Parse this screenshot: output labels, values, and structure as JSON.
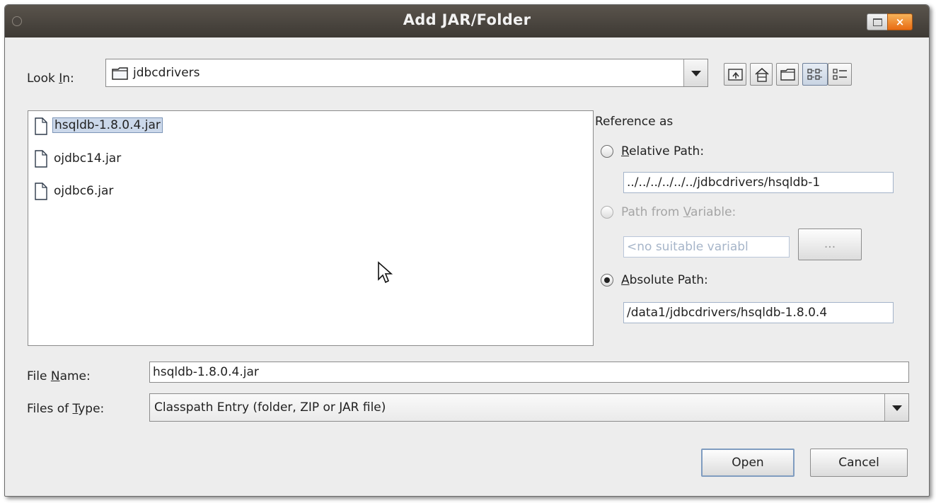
{
  "window": {
    "title": "Add JAR/Folder",
    "close_glyph": "×"
  },
  "lookin": {
    "label_pre": "Look ",
    "label_mn": "I",
    "label_post": "n:",
    "value": "jdbcdrivers"
  },
  "toolbar": {
    "icons": [
      "up-folder-icon",
      "home-icon",
      "new-folder-icon",
      "list-view-icon",
      "details-view-icon"
    ]
  },
  "files": [
    {
      "name": "hsqldb-1.8.0.4.jar",
      "selected": true
    },
    {
      "name": "ojdbc14.jar",
      "selected": false
    },
    {
      "name": "ojdbc6.jar",
      "selected": false
    }
  ],
  "reference": {
    "heading": "Reference as",
    "relative": {
      "mn": "R",
      "rest": "elative Path:",
      "value": "../../../../../../jdbcdrivers/hsqldb-1",
      "checked": false,
      "enabled": true
    },
    "variable": {
      "pre": "Path from ",
      "mn": "V",
      "rest": "ariable:",
      "value": "<no suitable variabl",
      "button": "...",
      "checked": false,
      "enabled": false
    },
    "absolute": {
      "mn": "A",
      "rest": "bsolute Path:",
      "value": "/data1/jdbcdrivers/hsqldb-1.8.0.4",
      "checked": true,
      "enabled": true
    }
  },
  "filename": {
    "label_pre": "File ",
    "label_mn": "N",
    "label_post": "ame:",
    "value": "hsqldb-1.8.0.4.jar"
  },
  "filetype": {
    "label_pre": "Files of ",
    "label_mn": "T",
    "label_post": "ype:",
    "value": "Classpath Entry (folder, ZIP or JAR file)"
  },
  "buttons": {
    "open": "Open",
    "cancel": "Cancel"
  },
  "colors": {
    "titlebar": "#3d3934",
    "selection": "#cbd8ea",
    "default_button_border": "#7f9cc0"
  }
}
